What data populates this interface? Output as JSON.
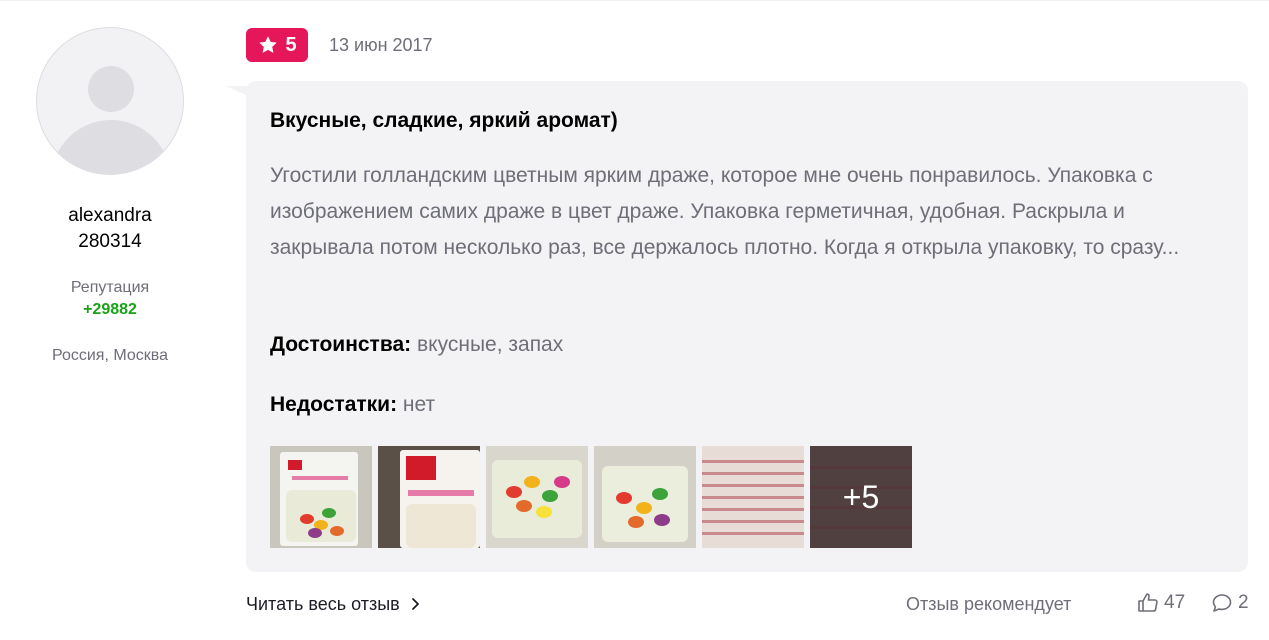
{
  "author": {
    "name_line1": "alexandra",
    "name_line2": "280314",
    "reputation_label": "Репутация",
    "reputation_value": "+29882",
    "location": "Россия, Москва"
  },
  "review": {
    "rating": "5",
    "date": "13 июн 2017",
    "title": "Вкусные, сладкие, яркий аромат)",
    "text": "Угостили голландским цветным ярким драже, которое мне очень понравилось. Упаковка с изображением самих драже в цвет драже. Упаковка герметичная, удобная. Раскрыла и закрывала потом несколько раз, все держалось плотно. Когда я открыла упаковку, то сразу...",
    "pros_label": "Достоинства:",
    "pros_value": "вкусные, запах",
    "cons_label": "Недостатки:",
    "cons_value": "нет",
    "photos_more": "+5"
  },
  "footer": {
    "read_more": "Читать весь отзыв",
    "recommends": "Отзыв рекомендует",
    "likes": "47",
    "comments": "2"
  },
  "colors": {
    "rating_badge": "#e5175a",
    "reputation": "#19a319",
    "card_background": "#f3f3f5"
  },
  "icons": {
    "rating": "star-icon",
    "read_more": "chevron-right-icon",
    "likes": "thumbs-up-icon",
    "comments": "comment-icon"
  }
}
